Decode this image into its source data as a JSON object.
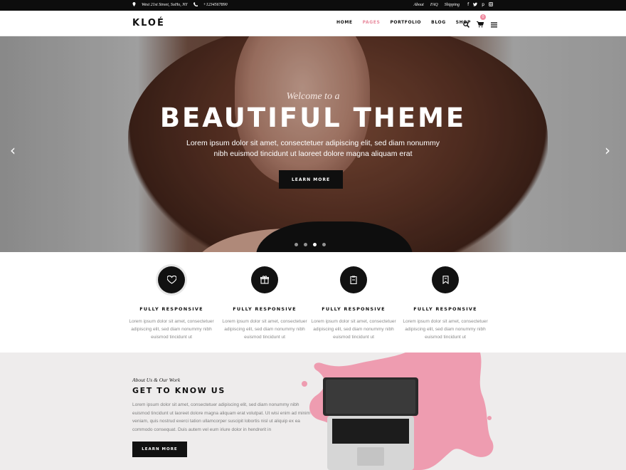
{
  "topbar": {
    "address": "West 21st Street, SoHo, NY",
    "phone": "+1234567890",
    "links": [
      "About",
      "FAQ",
      "Shipping"
    ],
    "social_icons": [
      "facebook-icon",
      "twitter-icon",
      "pinterest-icon",
      "instagram-icon"
    ]
  },
  "header": {
    "logo": "KLOÉ",
    "nav": [
      "HOME",
      "PAGES",
      "PORTFOLIO",
      "BLOG",
      "SHOP"
    ],
    "active_nav": "PAGES",
    "cart_count": "0"
  },
  "hero": {
    "welcome": "Welcome to a",
    "title": "BEAUTIFUL THEME",
    "subtitle": "Lorem ipsum dolor sit amet, consectetuer adipiscing elit, sed diam nonummy nibh euismod tincidunt ut laoreet dolore magna aliquam erat",
    "button": "LEARN MORE",
    "prev_icon": "‹",
    "next_icon": "›",
    "slides_total": 4,
    "active_slide": 3
  },
  "features": [
    {
      "icon": "heart-icon",
      "title": "FULLY RESPONSIVE",
      "text": "Lorem ipsum dolor sit amet, consectetuer adipiscing elit, sed diam nonummy nibh euismod tincidunt ut"
    },
    {
      "icon": "gift-icon",
      "title": "FULLY RESPONSIVE",
      "text": "Lorem ipsum dolor sit amet, consectetuer adipiscing elit, sed diam nonummy nibh euismod tincidunt ut"
    },
    {
      "icon": "clipboard-icon",
      "title": "FULLY RESPONSIVE",
      "text": "Lorem ipsum dolor sit amet, consectetuer adipiscing elit, sed diam nonummy nibh euismod tincidunt ut"
    },
    {
      "icon": "bookmark-icon",
      "title": "FULLY RESPONSIVE",
      "text": "Lorem ipsum dolor sit amet, consectetuer adipiscing elit, sed diam nonummy nibh euismod tincidunt ut"
    }
  ],
  "about": {
    "kicker": "About Us & Our Work",
    "title": "GET TO KNOW US",
    "text": "Lorem ipsum dolor sit amet, consectetuer adipiscing elit, sed diam nonummy nibh euismod tincidunt ut laoreet dolore magna aliquam erat volutpat. Ut wisi enim ad minim veniam, quis nostrud exerci tation ullamcorper suscipit lobortis nisl ut aliquip ex ea commodo consequat. Duis autem vel eum iriure dolor in hendrerit in",
    "button": "LEARN MORE"
  },
  "colors": {
    "accent": "#e88a9d",
    "dark": "#0f0f0f",
    "paint": "#ee9cb0"
  }
}
